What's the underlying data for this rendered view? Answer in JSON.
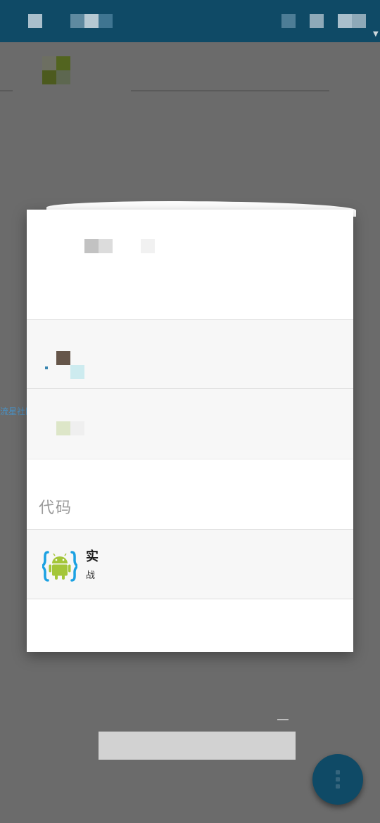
{
  "background": {
    "side_link": "流星社区"
  },
  "dialog": {
    "section_label": "代码",
    "app": {
      "title": "实",
      "subtitle": "战",
      "icon": "android-code-icon"
    }
  },
  "fab": {
    "icon": "more-vert-icon"
  },
  "colors": {
    "appbar": "#0f4a66",
    "scrim": "#6b6b6b",
    "fab": "#0f4a66",
    "android_green": "#a4c639",
    "brace_blue": "#1ba1e2"
  }
}
